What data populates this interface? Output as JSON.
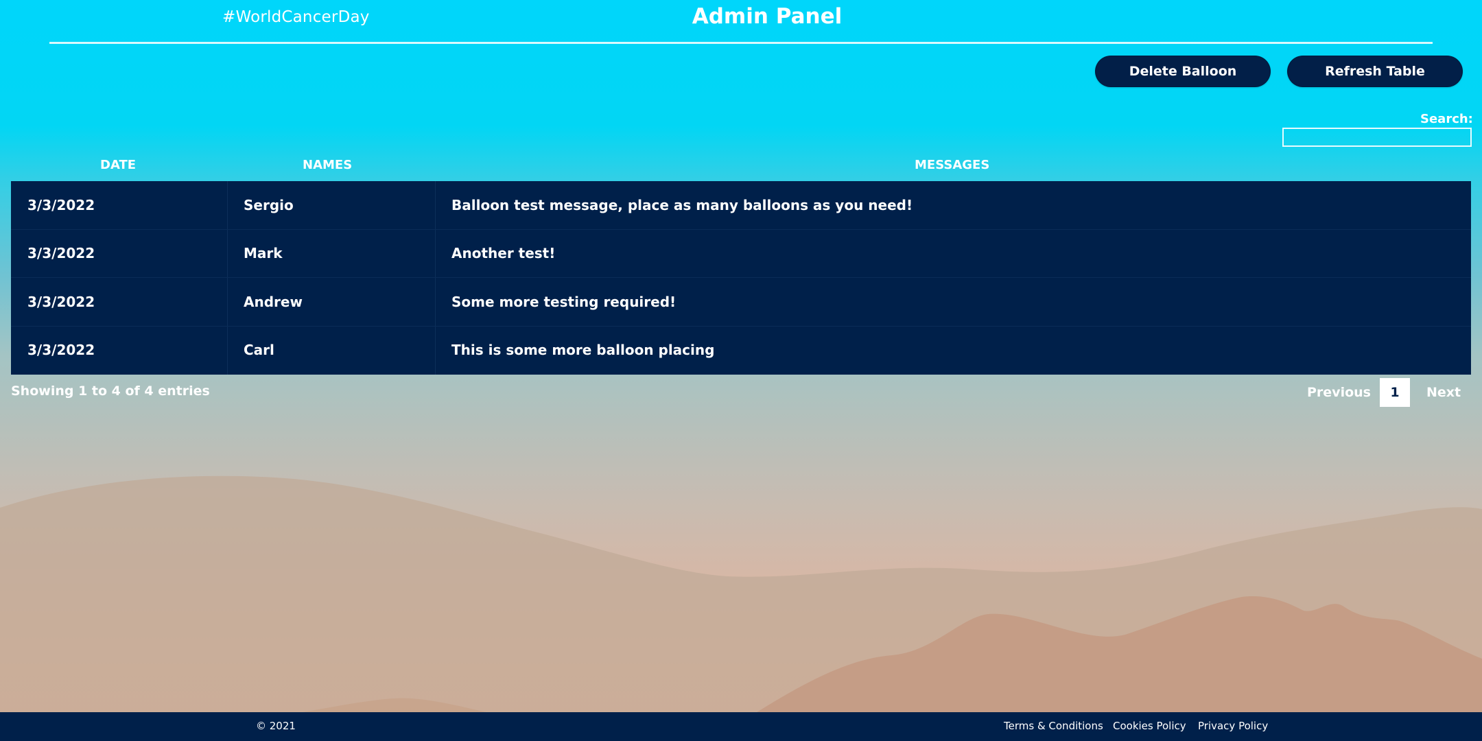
{
  "header": {
    "tagline": "#WorldCancerDay",
    "title": "Admin Panel"
  },
  "actions": {
    "delete_label": "Delete Balloon",
    "refresh_label": "Refresh Table"
  },
  "search": {
    "label": "Search:",
    "value": ""
  },
  "table": {
    "columns": [
      "DATE",
      "NAMES",
      "MESSAGES"
    ],
    "rows": [
      {
        "date": "3/3/2022",
        "name": "Sergio",
        "message": "Balloon test message, place as many balloons as you need!"
      },
      {
        "date": "3/3/2022",
        "name": "Mark",
        "message": "Another test!"
      },
      {
        "date": "3/3/2022",
        "name": "Andrew",
        "message": "Some more testing required!"
      },
      {
        "date": "3/3/2022",
        "name": "Carl",
        "message": "This is some more balloon placing"
      }
    ],
    "info": "Showing 1 to 4 of 4 entries"
  },
  "pagination": {
    "previous": "Previous",
    "current": "1",
    "next": "Next"
  },
  "footer": {
    "copyright": "© 2021",
    "links": [
      "Terms & Conditions",
      "Cookies Policy",
      "Privacy Policy"
    ]
  },
  "colors": {
    "navy": "#00204a",
    "sky_top": "#00d6fb",
    "sand_bottom": "#f0b597"
  }
}
